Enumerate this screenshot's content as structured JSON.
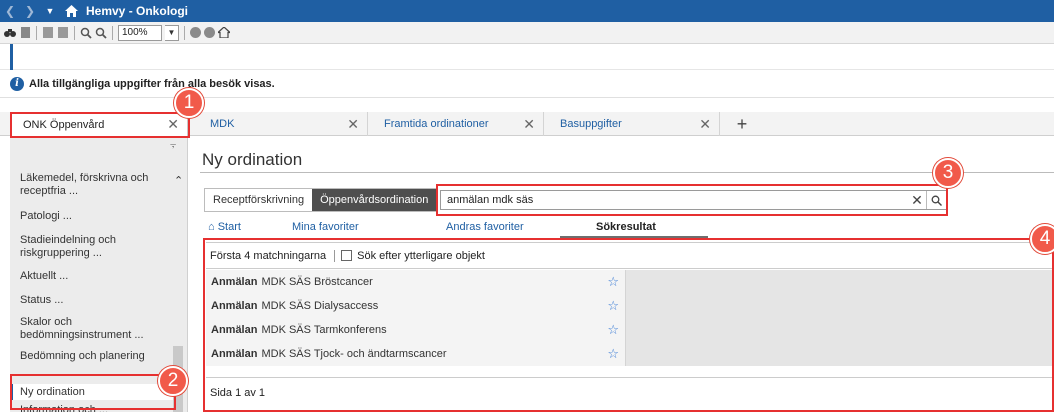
{
  "titlebar": {
    "title": "Hemvy - Onkologi",
    "back_icon": "chevron-left-icon",
    "forward_icon": "chevron-right-icon",
    "home_icon": "home-icon"
  },
  "toolbar": {
    "zoom_value": "100%"
  },
  "infobar": {
    "icon": "info-icon",
    "text": "Alla tillgängliga uppgifter från alla besök visas."
  },
  "tabs": [
    {
      "label": "ONK Öppenvård"
    },
    {
      "label": "MDK"
    },
    {
      "label": "Framtida ordinationer"
    },
    {
      "label": "Basuppgifter"
    },
    {
      "label": "+"
    }
  ],
  "sidebar": {
    "items": [
      {
        "label": "Läkemedel, förskrivna och receptfria ..."
      },
      {
        "label": "Patologi ..."
      },
      {
        "label": "Stadieindelning och riskgruppering ..."
      },
      {
        "label": "Aktuellt ..."
      },
      {
        "label": "Status ..."
      },
      {
        "label": "Skalor och bedömningsinstrument ..."
      },
      {
        "label": "Bedömning och planering"
      },
      {
        "label": "Ny ordination"
      },
      {
        "label": "Information och ..."
      }
    ]
  },
  "main": {
    "title": "Ny ordination",
    "segments": [
      "Receptförskrivning",
      "Öppenvårdsordination"
    ],
    "search": {
      "value": "anmälan mdk säs"
    },
    "subtabs": [
      "Start",
      "Mina favoriter",
      "Andras favoriter",
      "Sökresultat"
    ],
    "results": {
      "count_label": "Första 4 matchningarna",
      "checkbox_label": "Sök efter ytterligare objekt",
      "rows": [
        {
          "bold": "Anmälan",
          "rest": "MDK SÄS Bröstcancer"
        },
        {
          "bold": "Anmälan",
          "rest": "MDK SÄS Dialysaccess"
        },
        {
          "bold": "Anmälan",
          "rest": "MDK SÄS Tarmkonferens"
        },
        {
          "bold": "Anmälan",
          "rest": "MDK SÄS Tjock- och ändtarmscancer"
        }
      ],
      "footer": "Sida 1 av 1"
    }
  },
  "annotations": [
    "1",
    "2",
    "3",
    "4"
  ],
  "colors": {
    "titlebar": "#1f5fa3",
    "annotation_red": "#e63030",
    "selected_segment": "#4e4e4e",
    "link_blue": "#1f5fa3"
  }
}
